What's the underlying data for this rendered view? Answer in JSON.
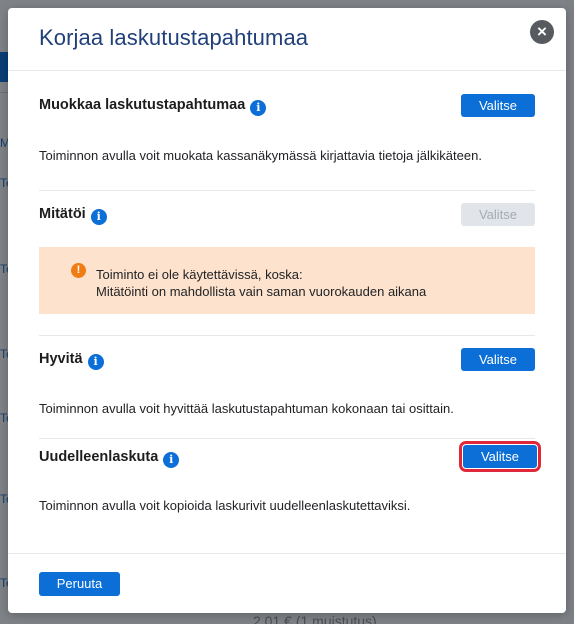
{
  "background": {
    "fragments": [
      "Te",
      "Te",
      "Te",
      "Te",
      "Te",
      "Te"
    ],
    "top_fragment": "M",
    "bottom_text": "2.01 € (1 muistutus)"
  },
  "modal": {
    "title": "Korjaa laskutustapahtumaa",
    "close_icon": "×",
    "sections": [
      {
        "title": "Muokkaa laskutustapahtumaa",
        "button_label": "Valitse",
        "button_state": "enabled",
        "description": "Toiminnon avulla voit muokata kassanäkymässä kirjattavia tietoja jälkikäteen."
      },
      {
        "title": "Mitätöi",
        "button_label": "Valitse",
        "button_state": "disabled",
        "warning": {
          "line1": "Toiminto ei ole käytettävissä, koska:",
          "line2": "Mitätöinti on mahdollista vain saman vuorokauden aikana"
        }
      },
      {
        "title": "Hyvitä",
        "button_label": "Valitse",
        "button_state": "enabled",
        "description": "Toiminnon avulla voit hyvittää laskutustapahtuman kokonaan tai osittain."
      },
      {
        "title": "Uudelleenlaskuta",
        "button_label": "Valitse",
        "button_state": "highlighted",
        "description": "Toiminnon avulla voit kopioida laskurivit uudelleenlaskutettaviksi."
      }
    ],
    "info_icon_glyph": "i",
    "warning_icon_glyph": "!",
    "footer": {
      "cancel_label": "Peruuta"
    }
  },
  "colors": {
    "accent": "#0b6fd7",
    "title": "#21407a",
    "warning_bg": "#fde3cd",
    "warning_icon": "#f07c14",
    "highlight": "#e0283b",
    "disabled_bg": "#e1e5ea"
  },
  "icons": {
    "close": "close-icon",
    "info": "info-icon",
    "warning": "warning-icon"
  }
}
